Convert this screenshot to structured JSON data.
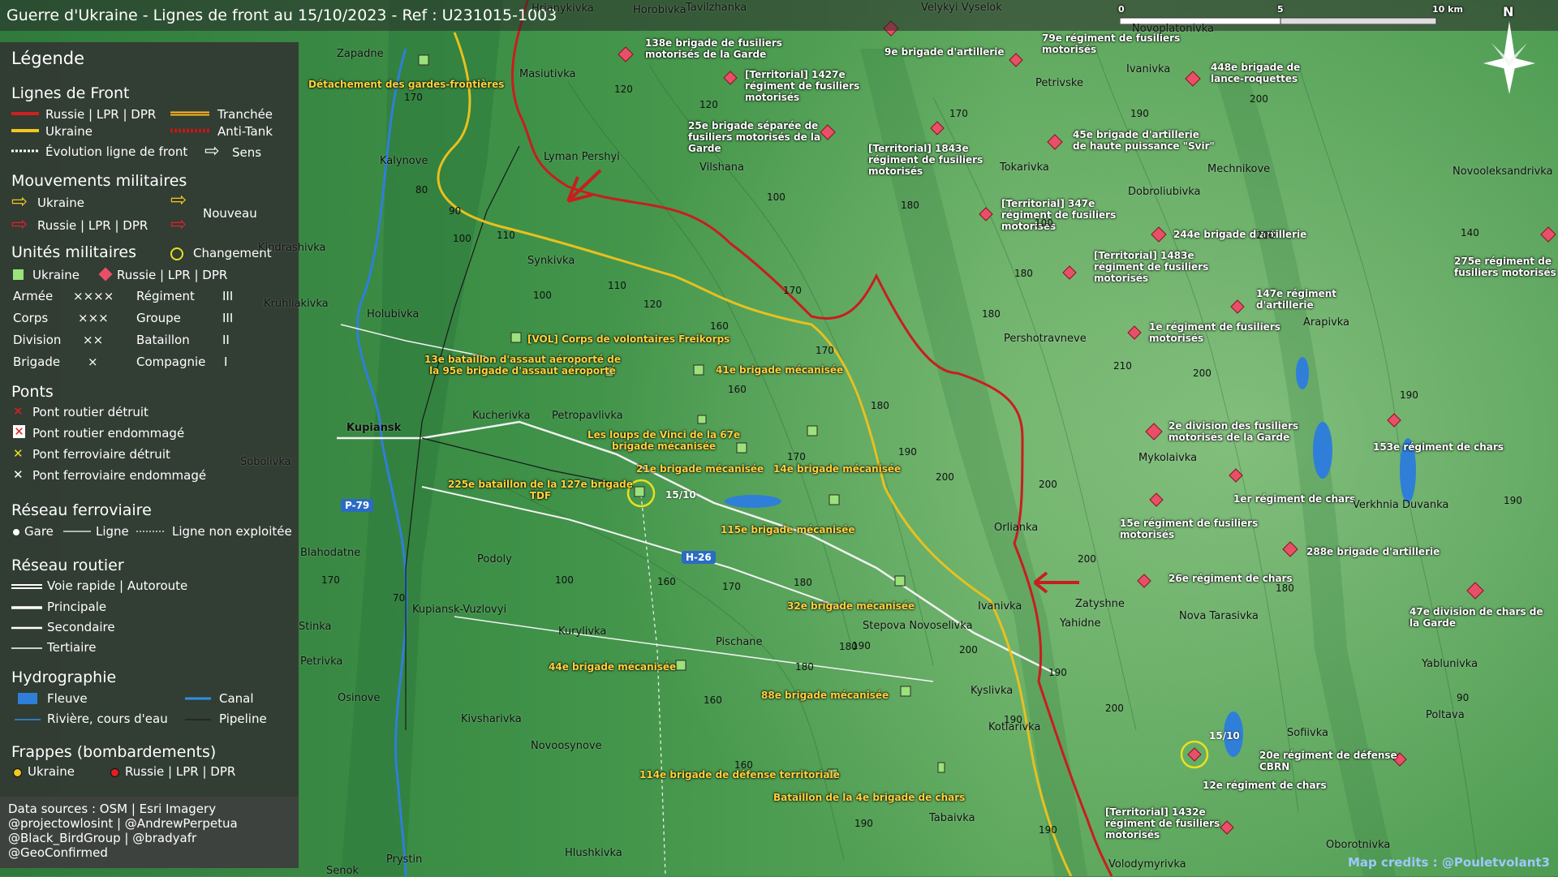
{
  "title": "Guerre d'Ukraine - Lignes de front au 15/10/2023 - Ref : U231015-1003",
  "scale": {
    "s0": "0",
    "s5": "5",
    "s10": "10 km"
  },
  "north": "N",
  "legend": {
    "title": "Légende",
    "front": {
      "title": "Lignes de Front",
      "ru": "Russie | LPR | DPR",
      "ua": "Ukraine",
      "trench": "Tranchée",
      "antitank": "Anti-Tank",
      "evolution": "Évolution ligne de front",
      "sens": "Sens"
    },
    "moves": {
      "title": "Mouvements militaires",
      "ua": "Ukraine",
      "ru": "Russie | LPR | DPR",
      "new": "Nouveau"
    },
    "units": {
      "title": "Unités militaires",
      "ua": "Ukraine",
      "ru": "Russie | LPR | DPR",
      "change": "Changement",
      "rows": [
        {
          "a": "Armée",
          "as": "××××",
          "b": "Régiment",
          "bs": "III"
        },
        {
          "a": "Corps",
          "as": "×××",
          "b": "Groupe",
          "bs": "III"
        },
        {
          "a": "Division",
          "as": "××",
          "b": "Bataillon",
          "bs": "II"
        },
        {
          "a": "Brigade",
          "as": "×",
          "b": "Compagnie",
          "bs": "I"
        }
      ]
    },
    "bridges": {
      "title": "Ponts",
      "items": [
        "Pont routier détruit",
        "Pont routier endommagé",
        "Pont ferroviaire détruit",
        "Pont ferroviaire endommagé"
      ]
    },
    "rail": {
      "title": "Réseau ferroviaire",
      "gare": "Gare",
      "ligne": "Ligne",
      "nonexp": "Ligne non exploitée"
    },
    "roads": {
      "title": "Réseau routier",
      "items": [
        "Voie rapide | Autoroute",
        "Principale",
        "Secondaire",
        "Tertiaire"
      ]
    },
    "hydro": {
      "title": "Hydrographie",
      "fleuve": "Fleuve",
      "canal": "Canal",
      "riviere": "Rivière, cours d'eau",
      "pipeline": "Pipeline"
    },
    "strikes": {
      "title": "Frappes (bombardements)",
      "ua": "Ukraine",
      "ru": "Russie | LPR | DPR"
    },
    "credits": [
      "Data sources : OSM | Esri Imagery",
      "@projectowlosint | @AndrewPerpetua",
      "@Black_BirdGroup | @bradyafr",
      "@GeoConfirmed"
    ]
  },
  "map_credit": "Map credits : @Pouletvolant3",
  "colors": {
    "ukraine": "#ffd23c",
    "russia": "#e0304a",
    "front_ru": "#c81e1e",
    "front_ua": "#e8c020",
    "water": "#2f7fd8"
  },
  "ua_units": [
    {
      "l1": "Détachement des gardes-frontières",
      "l2": ""
    },
    {
      "l1": "[VOL] Corps de volontaires Freikorps",
      "l2": ""
    },
    {
      "l1": "13e bataillon d'assaut aéroporté de",
      "l2": "la 95e brigade d'assaut aéroporté"
    },
    {
      "l1": "41e brigade mécanisée",
      "l2": ""
    },
    {
      "l1": "Les loups de Vinci de la 67e",
      "l2": "brigade mécanisée"
    },
    {
      "l1": "21e brigade mécanisée",
      "l2": ""
    },
    {
      "l1": "14e brigade mécanisée",
      "l2": ""
    },
    {
      "l1": "225e bataillon de la 127e brigade",
      "l2": "TDF"
    },
    {
      "l1": "115e brigade mécanisée",
      "l2": ""
    },
    {
      "l1": "32e brigade mécanisée",
      "l2": ""
    },
    {
      "l1": "44e brigade mécanisée",
      "l2": ""
    },
    {
      "l1": "88e brigade mécanisée",
      "l2": ""
    },
    {
      "l1": "114e brigade de défense territoriale",
      "l2": ""
    },
    {
      "l1": "Bataillon de la 4e brigade de chars",
      "l2": ""
    }
  ],
  "ru_units": [
    {
      "l1": "138e brigade de fusiliers",
      "l2": "motorisés de la Garde",
      "l3": ""
    },
    {
      "l1": "[Territorial] 1427e",
      "l2": "régiment de fusiliers",
      "l3": "motorisés"
    },
    {
      "l1": "25e brigade séparée de",
      "l2": "fusiliers motorisés de la",
      "l3": "Garde"
    },
    {
      "l1": "9e brigade d'artillerie",
      "l2": "",
      "l3": ""
    },
    {
      "l1": "[Territorial] 1843e",
      "l2": "régiment de fusiliers",
      "l3": "motorisés"
    },
    {
      "l1": "79e régiment de fusiliers",
      "l2": "motorisés",
      "l3": ""
    },
    {
      "l1": "448e brigade de",
      "l2": "lance-roquettes",
      "l3": ""
    },
    {
      "l1": "45e brigade d'artillerie",
      "l2": "de haute puissance \"Svir\"",
      "l3": ""
    },
    {
      "l1": "[Territorial] 347e",
      "l2": "régiment de fusiliers",
      "l3": "motorisés"
    },
    {
      "l1": "244e brigade d'artillerie",
      "l2": "",
      "l3": ""
    },
    {
      "l1": "[Territorial] 1483e",
      "l2": "régiment de fusiliers",
      "l3": "motorisés"
    },
    {
      "l1": "147e régiment",
      "l2": "d'artillerie",
      "l3": ""
    },
    {
      "l1": "1e régiment de fusiliers",
      "l2": "motorisés",
      "l3": ""
    },
    {
      "l1": "275e régiment de",
      "l2": "fusiliers motorisés",
      "l3": ""
    },
    {
      "l1": "2e division des fusiliers",
      "l2": "motorisés de la Garde",
      "l3": ""
    },
    {
      "l1": "153e régiment de chars",
      "l2": "",
      "l3": ""
    },
    {
      "l1": "1er régiment de chars",
      "l2": "",
      "l3": ""
    },
    {
      "l1": "15e régiment de fusiliers",
      "l2": "motorisés",
      "l3": ""
    },
    {
      "l1": "288e brigade d'artillerie",
      "l2": "",
      "l3": ""
    },
    {
      "l1": "26e régiment de chars",
      "l2": "",
      "l3": ""
    },
    {
      "l1": "47e division de chars de",
      "l2": "la Garde",
      "l3": ""
    },
    {
      "l1": "20e régiment de défense",
      "l2": "CBRN",
      "l3": ""
    },
    {
      "l1": "12e régiment de chars",
      "l2": "",
      "l3": ""
    },
    {
      "l1": "[Territorial] 1432e",
      "l2": "régiment de fusiliers",
      "l3": "motorisés"
    }
  ],
  "places": [
    "Hrianykivka",
    "Horobivka",
    "Tavilzhanka",
    "Velykyi Vyselok",
    "Novoplatonivka",
    "Zapadne",
    "Masiutivka",
    "Petrivske",
    "Ivanivka",
    "Lyman Pershyi",
    "Vilshana",
    "Kalynove",
    "Tokarivka",
    "Mechnikove",
    "Dobroliubivka",
    "Novooleksandrivka",
    "Kindrashivka",
    "Synkivka",
    "Kruhliakivka",
    "Holubivka",
    "Pershotravneve",
    "Arapivka",
    "Kucherivka",
    "Petropavlivka",
    "Kupiansk",
    "Mykolaivka",
    "Sobolivka",
    "Verkhnia Duvanka",
    "Orlianka",
    "Podoly",
    "Zatyshne",
    "Yahidne",
    "Nova Tarasivka",
    "Kupiansk-Vuzlovyi",
    "Kurylivka",
    "Stepova Novoselivka",
    "Ivanivka",
    "Pischane",
    "Kyslivka",
    "Yablunivka",
    "Osinove",
    "Kotlarivka",
    "Sofiivka",
    "Poltava",
    "Kivsharivka",
    "Novoosynove",
    "Tabaivka",
    "Prystin",
    "Hlushkivka",
    "Senok",
    "Volodymyrivka",
    "Oborotnivka",
    "Blahodatne",
    "Stinka",
    "Petrivka"
  ],
  "elevations": [
    "170",
    "120",
    "120",
    "100",
    "170",
    "180",
    "200",
    "190",
    "80",
    "90",
    "100",
    "110",
    "100",
    "110",
    "120",
    "170",
    "160",
    "170",
    "180",
    "180",
    "200",
    "210",
    "200",
    "190",
    "140",
    "160",
    "190",
    "200",
    "200",
    "170",
    "200",
    "180",
    "100",
    "160",
    "170",
    "180",
    "180",
    "190",
    "200",
    "70",
    "170",
    "160",
    "200",
    "190",
    "180",
    "90",
    "190",
    "190",
    "190",
    "180",
    "160",
    "190",
    "100"
  ],
  "roads": [
    "P-79",
    "H-26"
  ],
  "dates": [
    "15/10",
    "15/10"
  ]
}
